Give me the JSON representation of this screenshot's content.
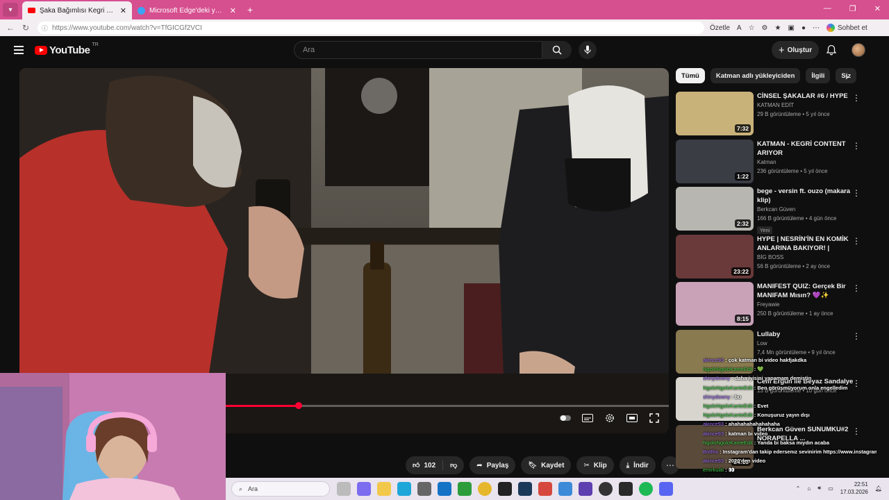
{
  "browser": {
    "tabs": [
      {
        "title": "Şaka Bağımlısı Kegri Tedavi Oldu",
        "active": true,
        "favicon_color": "#ff0000"
      },
      {
        "title": "Microsoft Edge'deki yenilikler",
        "active": false,
        "favicon_color": "#3aa4f5"
      }
    ],
    "url": "https://www.youtube.com/watch?v=TfGICGf2VCI",
    "summarize_label": "Özetle",
    "copilot_label": "Sohbet et",
    "accent_color": "#d64f8f"
  },
  "youtube": {
    "logo_text": "YouTube",
    "country_code": "TR",
    "search_placeholder": "Ara",
    "create_label": "Oluştur"
  },
  "player": {
    "progress_fraction": 0.43,
    "like_count": "102",
    "actions": {
      "share": "Paylaş",
      "save": "Kaydet",
      "clip": "Klip",
      "download": "İndir"
    }
  },
  "sidebar": {
    "chips": [
      "Tümü",
      "Katman adlı yükleyiciden",
      "İlgili",
      "Siz"
    ],
    "recommendations": [
      {
        "title": "CİNSEL ŞAKALAR #6 / HYPE",
        "channel": "KATMAN EDİT",
        "stats": "29 B görüntüleme • 5 yıl önce",
        "duration": "7:32",
        "thumb": "#c9b27a"
      },
      {
        "title": "KATMAN - KEGRİ CONTENT ARIYOR",
        "channel": "Katman",
        "stats": "236 görüntüleme • 5 yıl önce",
        "duration": "1:22",
        "thumb": "#3a3d44"
      },
      {
        "title": "bege - versin ft. ouzo (makara klip)",
        "channel": "Berkcan Güven",
        "stats": "166 B görüntüleme • 4 gün önce",
        "duration": "2:32",
        "badge": "Yeni",
        "thumb": "#b8b6b0"
      },
      {
        "title": "HYPE | NESRİN'İN EN KOMİK ANLARINA BAKIYOR! | JAHREI...",
        "channel": "BİG BOSS",
        "stats": "56 B görüntüleme • 2 ay önce",
        "duration": "23:22",
        "thumb": "#6a3a3a"
      },
      {
        "title": "MANIFEST QUIZ: Gerçek Bir MANIFAM Mısın? 💜✨",
        "channel": "Freyawie",
        "stats": "250 B görüntüleme • 1 ay önce",
        "duration": "8:15",
        "thumb": "#c9a2b8"
      },
      {
        "title": "Lullaby",
        "channel": "Low",
        "stats": "7,4 Mn görüntüleme • 9 yıl önce",
        "duration": "",
        "thumb": "#8a7a50"
      },
      {
        "title": "Cem Ergün ile Beyaz Sandalye",
        "channel": "",
        "stats": "13 B görüntüleme • 10 gün önce",
        "duration": "",
        "thumb": "#d8d5cf"
      },
      {
        "title": "Berkcan Güven SUNUMKU#2 NORAPELLA ...",
        "channel": "",
        "stats": "",
        "duration": "24:13",
        "thumb": "#5a4a3a"
      }
    ]
  },
  "chat": [
    {
      "user": "akince93",
      "color": "purple",
      "text": "çok katman bi video hakfjakdka"
    },
    {
      "user": "NgoloNgoloKanteEdit",
      "color": "green",
      "text": "💚"
    },
    {
      "user": "shinydowny",
      "color": "purple",
      "text": "daha iyisini yapamam demiştin"
    },
    {
      "user": "NgoloNgoloKanteEdit",
      "color": "green",
      "text": "Ben görüşmüyorum onla engelledim"
    },
    {
      "user": "shinydowny",
      "color": "purple",
      "text": "bu"
    },
    {
      "user": "NgoloNgoloKanteEdit",
      "color": "green",
      "text": "Evet"
    },
    {
      "user": "NgoloNgoloKanteEdit",
      "color": "green",
      "text": "Konuşuruz yayın dışı"
    },
    {
      "user": "akince93",
      "color": "purple",
      "text": "ahahahahahahahaha"
    },
    {
      "user": "akince93",
      "color": "purple",
      "text": "katman bi video"
    },
    {
      "user": "NgoloNgoloKanteEdit",
      "color": "green",
      "text": "Yanda bi baksa mıydın acaba"
    },
    {
      "user": "BotRix",
      "color": "purple",
      "text": "Instagram'dan takip edersenız sevinirim https://www.instagram.com/hulyayarar/"
    },
    {
      "user": "akince93",
      "color": "purple",
      "text": "2020'den video"
    },
    {
      "user": "emirkulal",
      "color": "green",
      "text": "👀"
    },
    {
      "user": "d_hazal_x",
      "color": "pink",
      "text": ""
    }
  ],
  "taskbar": {
    "search_placeholder": "Ara",
    "time": "22:51",
    "date": "17.03.2026"
  }
}
